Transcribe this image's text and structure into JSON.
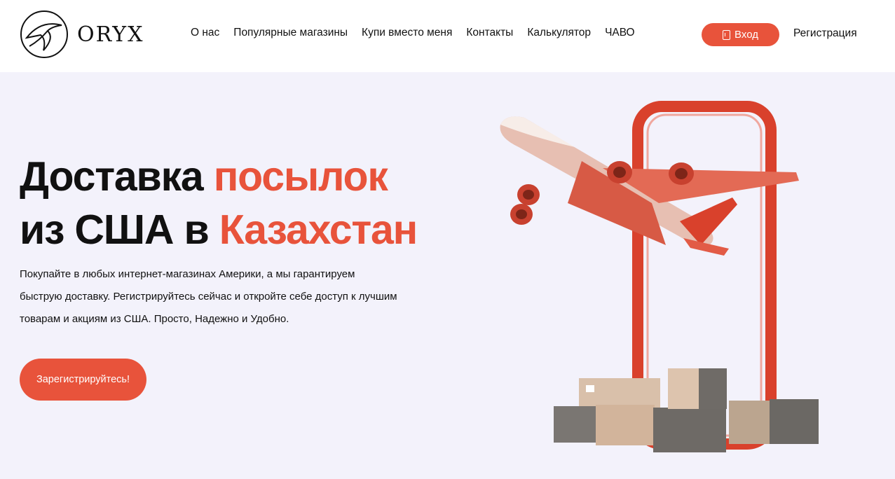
{
  "brand": {
    "name": "ORYX",
    "accent": "#e8533b"
  },
  "nav": {
    "items": [
      {
        "label": "О нас"
      },
      {
        "label": "Популярные магазины"
      },
      {
        "label": "Купи вместо меня"
      },
      {
        "label": "Контакты"
      },
      {
        "label": "Калькулятор"
      },
      {
        "label": "ЧАВО"
      }
    ],
    "login_label": "Вход",
    "login_icon": "door-icon",
    "register_label": "Регистрация"
  },
  "hero": {
    "title_line1_dark": "Доставка ",
    "title_line1_accent": "посылок",
    "title_line2_dark": "из США в ",
    "title_line2_accent": "Казахстан",
    "description": "Покупайте в любых интернет-магазинах Америки, а мы гарантируем быструю доставку. Регистрируйтесь сейчас и откройте себе доступ к лучшим товарам и акциям из США. Просто, Надежно и Удобно.",
    "cta_label": "Зарегистрируйтесь!"
  },
  "illustration": {
    "icon": "airplane-phone-boxes-illustration"
  }
}
